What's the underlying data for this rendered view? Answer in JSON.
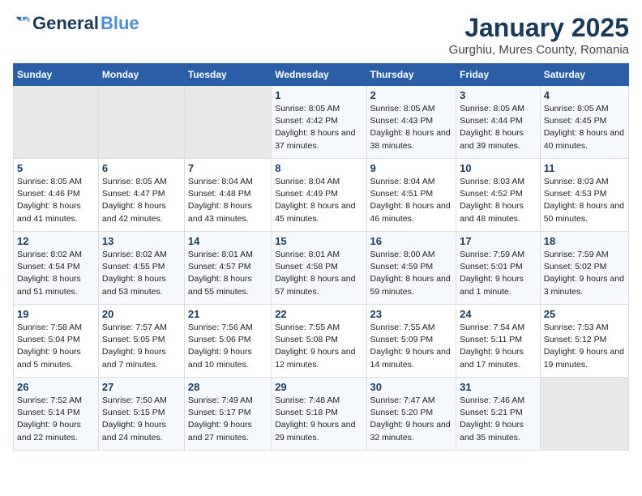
{
  "logo": {
    "general": "General",
    "blue": "Blue"
  },
  "title": "January 2025",
  "subtitle": "Gurghiu, Mures County, Romania",
  "headers": [
    "Sunday",
    "Monday",
    "Tuesday",
    "Wednesday",
    "Thursday",
    "Friday",
    "Saturday"
  ],
  "weeks": [
    [
      {
        "num": "",
        "info": ""
      },
      {
        "num": "",
        "info": ""
      },
      {
        "num": "",
        "info": ""
      },
      {
        "num": "1",
        "info": "Sunrise: 8:05 AM\nSunset: 4:42 PM\nDaylight: 8 hours and 37 minutes."
      },
      {
        "num": "2",
        "info": "Sunrise: 8:05 AM\nSunset: 4:43 PM\nDaylight: 8 hours and 38 minutes."
      },
      {
        "num": "3",
        "info": "Sunrise: 8:05 AM\nSunset: 4:44 PM\nDaylight: 8 hours and 39 minutes."
      },
      {
        "num": "4",
        "info": "Sunrise: 8:05 AM\nSunset: 4:45 PM\nDaylight: 8 hours and 40 minutes."
      }
    ],
    [
      {
        "num": "5",
        "info": "Sunrise: 8:05 AM\nSunset: 4:46 PM\nDaylight: 8 hours and 41 minutes."
      },
      {
        "num": "6",
        "info": "Sunrise: 8:05 AM\nSunset: 4:47 PM\nDaylight: 8 hours and 42 minutes."
      },
      {
        "num": "7",
        "info": "Sunrise: 8:04 AM\nSunset: 4:48 PM\nDaylight: 8 hours and 43 minutes."
      },
      {
        "num": "8",
        "info": "Sunrise: 8:04 AM\nSunset: 4:49 PM\nDaylight: 8 hours and 45 minutes."
      },
      {
        "num": "9",
        "info": "Sunrise: 8:04 AM\nSunset: 4:51 PM\nDaylight: 8 hours and 46 minutes."
      },
      {
        "num": "10",
        "info": "Sunrise: 8:03 AM\nSunset: 4:52 PM\nDaylight: 8 hours and 48 minutes."
      },
      {
        "num": "11",
        "info": "Sunrise: 8:03 AM\nSunset: 4:53 PM\nDaylight: 8 hours and 50 minutes."
      }
    ],
    [
      {
        "num": "12",
        "info": "Sunrise: 8:02 AM\nSunset: 4:54 PM\nDaylight: 8 hours and 51 minutes."
      },
      {
        "num": "13",
        "info": "Sunrise: 8:02 AM\nSunset: 4:55 PM\nDaylight: 8 hours and 53 minutes."
      },
      {
        "num": "14",
        "info": "Sunrise: 8:01 AM\nSunset: 4:57 PM\nDaylight: 8 hours and 55 minutes."
      },
      {
        "num": "15",
        "info": "Sunrise: 8:01 AM\nSunset: 4:58 PM\nDaylight: 8 hours and 57 minutes."
      },
      {
        "num": "16",
        "info": "Sunrise: 8:00 AM\nSunset: 4:59 PM\nDaylight: 8 hours and 59 minutes."
      },
      {
        "num": "17",
        "info": "Sunrise: 7:59 AM\nSunset: 5:01 PM\nDaylight: 9 hours and 1 minute."
      },
      {
        "num": "18",
        "info": "Sunrise: 7:59 AM\nSunset: 5:02 PM\nDaylight: 9 hours and 3 minutes."
      }
    ],
    [
      {
        "num": "19",
        "info": "Sunrise: 7:58 AM\nSunset: 5:04 PM\nDaylight: 9 hours and 5 minutes."
      },
      {
        "num": "20",
        "info": "Sunrise: 7:57 AM\nSunset: 5:05 PM\nDaylight: 9 hours and 7 minutes."
      },
      {
        "num": "21",
        "info": "Sunrise: 7:56 AM\nSunset: 5:06 PM\nDaylight: 9 hours and 10 minutes."
      },
      {
        "num": "22",
        "info": "Sunrise: 7:55 AM\nSunset: 5:08 PM\nDaylight: 9 hours and 12 minutes."
      },
      {
        "num": "23",
        "info": "Sunrise: 7:55 AM\nSunset: 5:09 PM\nDaylight: 9 hours and 14 minutes."
      },
      {
        "num": "24",
        "info": "Sunrise: 7:54 AM\nSunset: 5:11 PM\nDaylight: 9 hours and 17 minutes."
      },
      {
        "num": "25",
        "info": "Sunrise: 7:53 AM\nSunset: 5:12 PM\nDaylight: 9 hours and 19 minutes."
      }
    ],
    [
      {
        "num": "26",
        "info": "Sunrise: 7:52 AM\nSunset: 5:14 PM\nDaylight: 9 hours and 22 minutes."
      },
      {
        "num": "27",
        "info": "Sunrise: 7:50 AM\nSunset: 5:15 PM\nDaylight: 9 hours and 24 minutes."
      },
      {
        "num": "28",
        "info": "Sunrise: 7:49 AM\nSunset: 5:17 PM\nDaylight: 9 hours and 27 minutes."
      },
      {
        "num": "29",
        "info": "Sunrise: 7:48 AM\nSunset: 5:18 PM\nDaylight: 9 hours and 29 minutes."
      },
      {
        "num": "30",
        "info": "Sunrise: 7:47 AM\nSunset: 5:20 PM\nDaylight: 9 hours and 32 minutes."
      },
      {
        "num": "31",
        "info": "Sunrise: 7:46 AM\nSunset: 5:21 PM\nDaylight: 9 hours and 35 minutes."
      },
      {
        "num": "",
        "info": ""
      }
    ]
  ]
}
